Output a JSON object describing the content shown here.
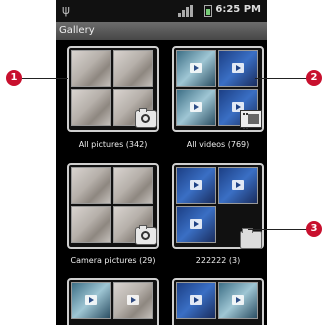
{
  "status_bar": {
    "time": "6:25 PM",
    "icons": [
      "usb-icon",
      "signal-icon",
      "battery-icon"
    ]
  },
  "title_bar": {
    "title": "Gallery"
  },
  "albums": [
    {
      "label": "All pictures (342)",
      "badge": "camera-icon"
    },
    {
      "label": "All videos (769)",
      "badge": "film-icon"
    },
    {
      "label": "Camera pictures (29)",
      "badge": "camera-icon"
    },
    {
      "label": "222222 (3)",
      "badge": "folder-icon"
    },
    {
      "label": "",
      "badge": ""
    },
    {
      "label": "",
      "badge": ""
    }
  ],
  "callouts": [
    "1",
    "2",
    "3"
  ],
  "colors": {
    "marker": "#c8102e",
    "background": "#000000",
    "title_bar": "#5a5a5a"
  }
}
